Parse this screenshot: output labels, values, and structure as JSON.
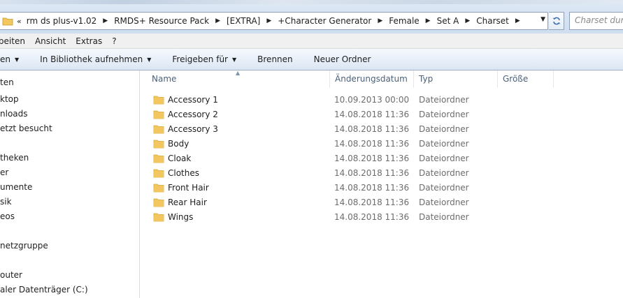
{
  "address": {
    "overflow_chevron": "«",
    "crumbs": [
      "rm ds plus-v1.02",
      "RMDS+ Resource Pack",
      "[EXTRA]",
      "+Character Generator",
      "Female",
      "Set A",
      "Charset"
    ],
    "separator": "▶",
    "dropdown": "▼"
  },
  "search": {
    "placeholder": "Charset durchsuchen"
  },
  "menu": {
    "items": [
      "rbeiten",
      "Ansicht",
      "Extras",
      "?"
    ]
  },
  "commands": [
    {
      "label": "en",
      "arrow": "▼"
    },
    {
      "label": "In Bibliothek aufnehmen",
      "arrow": "▼"
    },
    {
      "label": "Freigeben für",
      "arrow": "▼"
    },
    {
      "label": "Brennen",
      "arrow": ""
    },
    {
      "label": "Neuer Ordner",
      "arrow": ""
    }
  ],
  "nav": {
    "items": [
      "ten",
      "ktop",
      "nloads",
      "etzt besucht",
      "theken",
      "er",
      "umente",
      "sik",
      "eos",
      "netzgruppe",
      "outer",
      "aler Datenträger (C:)"
    ]
  },
  "columns": {
    "name": "Name",
    "date": "Änderungsdatum",
    "type": "Typ",
    "size": "Größe",
    "sort_indicator": "▲"
  },
  "files": [
    {
      "name": "Accessory 1",
      "date": "10.09.2013 00:00",
      "type": "Dateiordner",
      "size": ""
    },
    {
      "name": "Accessory 2",
      "date": "14.08.2018 11:36",
      "type": "Dateiordner",
      "size": ""
    },
    {
      "name": "Accessory 3",
      "date": "14.08.2018 11:36",
      "type": "Dateiordner",
      "size": ""
    },
    {
      "name": "Body",
      "date": "14.08.2018 11:36",
      "type": "Dateiordner",
      "size": ""
    },
    {
      "name": "Cloak",
      "date": "14.08.2018 11:36",
      "type": "Dateiordner",
      "size": ""
    },
    {
      "name": "Clothes",
      "date": "14.08.2018 11:36",
      "type": "Dateiordner",
      "size": ""
    },
    {
      "name": "Front Hair",
      "date": "14.08.2018 11:36",
      "type": "Dateiordner",
      "size": ""
    },
    {
      "name": "Rear Hair",
      "date": "14.08.2018 11:36",
      "type": "Dateiordner",
      "size": ""
    },
    {
      "name": "Wings",
      "date": "14.08.2018 11:36",
      "type": "Dateiordner",
      "size": ""
    }
  ],
  "colors": {
    "folder": "#f3c760",
    "folder_dark": "#d9a52f",
    "header_text": "#4c607a"
  },
  "icons": {
    "folder": "folder-icon",
    "refresh": "refresh-icon"
  }
}
